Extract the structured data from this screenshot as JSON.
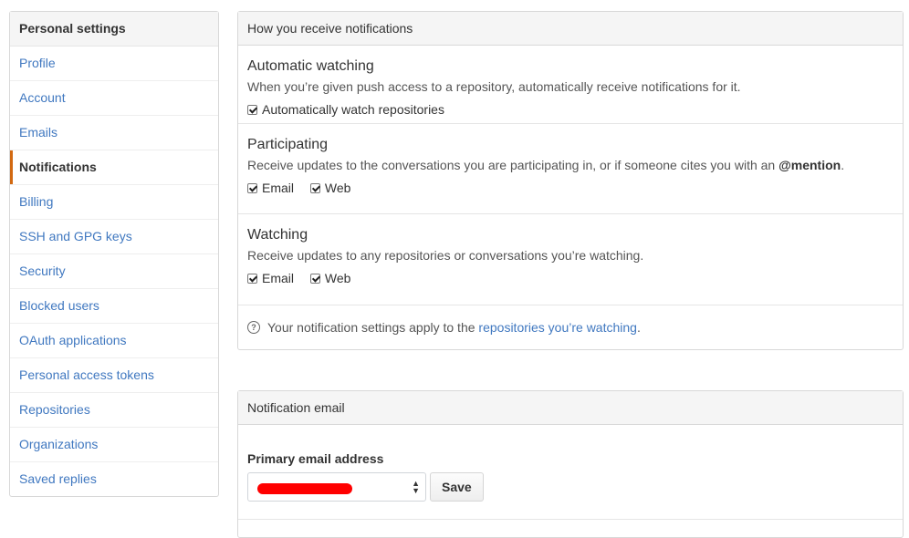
{
  "sidebar": {
    "header": "Personal settings",
    "items": [
      {
        "label": "Profile"
      },
      {
        "label": "Account"
      },
      {
        "label": "Emails"
      },
      {
        "label": "Notifications",
        "selected": true
      },
      {
        "label": "Billing"
      },
      {
        "label": "SSH and GPG keys"
      },
      {
        "label": "Security"
      },
      {
        "label": "Blocked users"
      },
      {
        "label": "OAuth applications"
      },
      {
        "label": "Personal access tokens"
      },
      {
        "label": "Repositories"
      },
      {
        "label": "Organizations"
      },
      {
        "label": "Saved replies"
      }
    ]
  },
  "notifications": {
    "header": "How you receive notifications",
    "automatic": {
      "title": "Automatic watching",
      "desc": "When you’re given push access to a repository, automatically receive notifications for it.",
      "checkbox_label": "Automatically watch repositories",
      "checked": true
    },
    "participating": {
      "title": "Participating",
      "desc_prefix": "Receive updates to the conversations you are participating in, or if someone cites you with an ",
      "desc_mention": "@mention",
      "desc_suffix": ".",
      "email_label": "Email",
      "web_label": "Web"
    },
    "watching": {
      "title": "Watching",
      "desc": "Receive updates to any repositories or conversations you’re watching.",
      "email_label": "Email",
      "web_label": "Web"
    },
    "note": {
      "icon_glyph": "?",
      "prefix": "Your notification settings apply to the ",
      "link": "repositories you’re watching",
      "suffix": "."
    }
  },
  "email_section": {
    "header": "Notification email",
    "field_label": "Primary email address",
    "save_label": "Save"
  },
  "colors": {
    "link": "#4078c0",
    "selected_marker": "#d26911",
    "redaction": "#ff0000"
  }
}
